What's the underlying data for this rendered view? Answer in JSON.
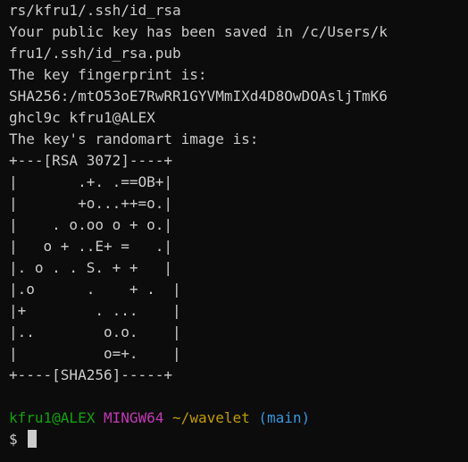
{
  "terminal": {
    "output_lines": [
      "rs/kfru1/.ssh/id_rsa",
      "Your public key has been saved in /c/Users/k",
      "fru1/.ssh/id_rsa.pub",
      "The key fingerprint is:",
      "SHA256:/mtO53oE7RwRR1GYVMmIXd4D8OwDOAsljTmK6",
      "ghcl9c kfru1@ALEX",
      "The key's randomart image is:",
      "+---[RSA 3072]----+",
      "|       .+. .==OB+|",
      "|       +o...++=o.|",
      "|    . o.oo o + o.|",
      "|   o + ..E+ =   .|",
      "|. o . . S. + +   |",
      "|.o      .    + .  |",
      "|+        . ...    |",
      "|..        o.o.    |",
      "|          o=+.    |",
      "+----[SHA256]-----+"
    ],
    "prompt": {
      "user_host": "kfru1@ALEX",
      "system": "MINGW64",
      "path": "~/wavelet",
      "branch": "(main)",
      "symbol": "$"
    },
    "colors": {
      "background": "#0c0c0c",
      "foreground": "#cccccc",
      "user_host": "#13a10e",
      "system": "#c239b3",
      "path": "#c19c00",
      "branch": "#3a96dd"
    }
  }
}
